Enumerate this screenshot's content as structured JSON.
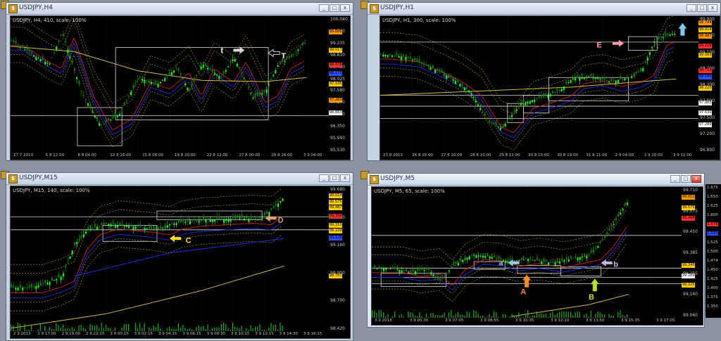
{
  "windows": [
    {
      "id": "h4",
      "title": "USDJPY,H4",
      "label": "USDJPY, H4, 410, scale: 100%",
      "yticks": [
        "100.040",
        "99.640",
        "99.235",
        "98.810",
        "98.430",
        "98.025",
        "97.580",
        "97.170",
        "96.760",
        "96.350",
        "95.940",
        "95.530"
      ],
      "tags": [
        {
          "t": "99.688",
          "c": "#ff9900"
        },
        {
          "t": "99.017",
          "c": "#ffcc00"
        },
        {
          "t": "98.476",
          "c": "#ff3030"
        },
        {
          "t": "98.173",
          "c": "#3050ff"
        },
        {
          "t": "97.936",
          "c": "#ffcc00"
        },
        {
          "t": "97.265",
          "c": "#ff9900"
        },
        {
          "t": "96.883",
          "c": "#ffffff"
        }
      ],
      "xticks": [
        "27 7 2013",
        "5 8 12:00",
        "8 8 04:00",
        "12 8 16:00",
        "15 8 08:00",
        "19 8 20:00",
        "22 8 12:00",
        "27 8 00:00",
        "29 8 16:00",
        "3 9 04:00"
      ]
    },
    {
      "id": "h1",
      "title": "USDJPY,H1",
      "label": "USDJPY, H1, 300, scale: 100%",
      "yticks": [
        "99.900",
        "99.500",
        "99.100",
        "98.700",
        "98.300",
        "97.900",
        "97.500",
        "97.200",
        "96.800"
      ],
      "tags": [
        {
          "t": "99.744",
          "c": "#ff9900"
        },
        {
          "t": "99.614",
          "c": "#ffcc00"
        },
        {
          "t": "99.487",
          "c": "#ff9900"
        },
        {
          "t": "99.229",
          "c": "#ff3030"
        },
        {
          "t": "99.083",
          "c": "#ffcc00"
        },
        {
          "t": "98.714",
          "c": "#ff3030"
        },
        {
          "t": "98.590",
          "c": "#3050ff"
        },
        {
          "t": "98.225",
          "c": "#ffcc00"
        },
        {
          "t": "97.885",
          "c": "#ffffff"
        },
        {
          "t": "97.630",
          "c": "#ffffff"
        },
        {
          "t": "97.289",
          "c": "#ffffff"
        }
      ],
      "xticks": [
        "23 8 2013",
        "26 8 10:00",
        "27 8 10:00",
        "28 8 10:00",
        "29 8 11:00",
        "30 8 03:00",
        "30 8 19:00",
        "31 8 11:00",
        "2 9 04:00",
        "2 9 20:00",
        "3 9 12:00"
      ]
    },
    {
      "id": "m15",
      "title": "USDJPY,M15",
      "label": "USDJPY, M15, 140, scale: 100%",
      "yticks": [
        "99.680",
        "99.420",
        "99.160",
        "98.900",
        "98.700",
        "98.420"
      ],
      "tags": [
        {
          "t": "99.614",
          "c": "#ffcc00"
        },
        {
          "t": "99.575",
          "c": "#ffcc00"
        },
        {
          "t": "99.487",
          "c": "#ffcc00"
        },
        {
          "t": "99.398",
          "c": "#ff3030"
        },
        {
          "t": "99.310",
          "c": "#ffcc00"
        },
        {
          "t": "99.229",
          "c": "#ffcc00"
        },
        {
          "t": "99.120",
          "c": "#3050ff"
        },
        {
          "t": "98.781",
          "c": "#ffcc00"
        }
      ],
      "xticks": [
        "2 9 2013",
        "2 9 17:00",
        "2 9 19:00",
        "2 9 22:15",
        "3 9 00:15",
        "3 9 02:15",
        "3 9 04:15",
        "3 9 06:15",
        "3 9 08:30",
        "3 9 10:15",
        "3 9 12:15",
        "3 9 14:30",
        "3 9 16:15"
      ]
    },
    {
      "id": "m5",
      "title": "USDJPY,M5",
      "label": "USDJPY, M5, 65, scale: 100%",
      "yticks": [
        "99.710",
        "99.575",
        "99.450",
        "99.385",
        "99.255",
        "99.160",
        "99.060"
      ],
      "tags": [
        {
          "t": "99.651",
          "c": "#ff9900"
        },
        {
          "t": "99.575",
          "c": "#ffcc00"
        },
        {
          "t": "99.498",
          "c": "#ff3030"
        },
        {
          "t": "99.340",
          "c": "#ffcc00"
        },
        {
          "t": "99.289",
          "c": "#ffffff"
        },
        {
          "t": "99.225",
          "c": "#ffcc00"
        }
      ],
      "xticks": [
        "3 9 2013",
        "3 9 05:30",
        "3 9 07:05",
        "3 9 08:55",
        "3 9 10:35",
        "3 9 12:10",
        "3 9 13:50",
        "3 9 15:35",
        "3 9 17:05"
      ]
    }
  ],
  "annotations": {
    "t_small": "t",
    "T_big": "T",
    "E": "E",
    "C": "C",
    "D": "D",
    "a": "a",
    "b": "b",
    "A": "A",
    "B": "B"
  },
  "background_side_tags": [
    "1.675",
    "1.650",
    "1.625",
    "1.600",
    "1.578",
    "1.550",
    "1.525",
    "1.500",
    "1.474",
    "1.450",
    "1.425",
    "1.400",
    "1.375",
    "1.350"
  ],
  "colors": {
    "candle_up": "#23ff23",
    "candle_down": "#0f8a0f",
    "band_outer": "#c8a020",
    "band_red": "#d02020",
    "band_blue": "#2030e0",
    "ma_yellow": "#d0c040"
  }
}
